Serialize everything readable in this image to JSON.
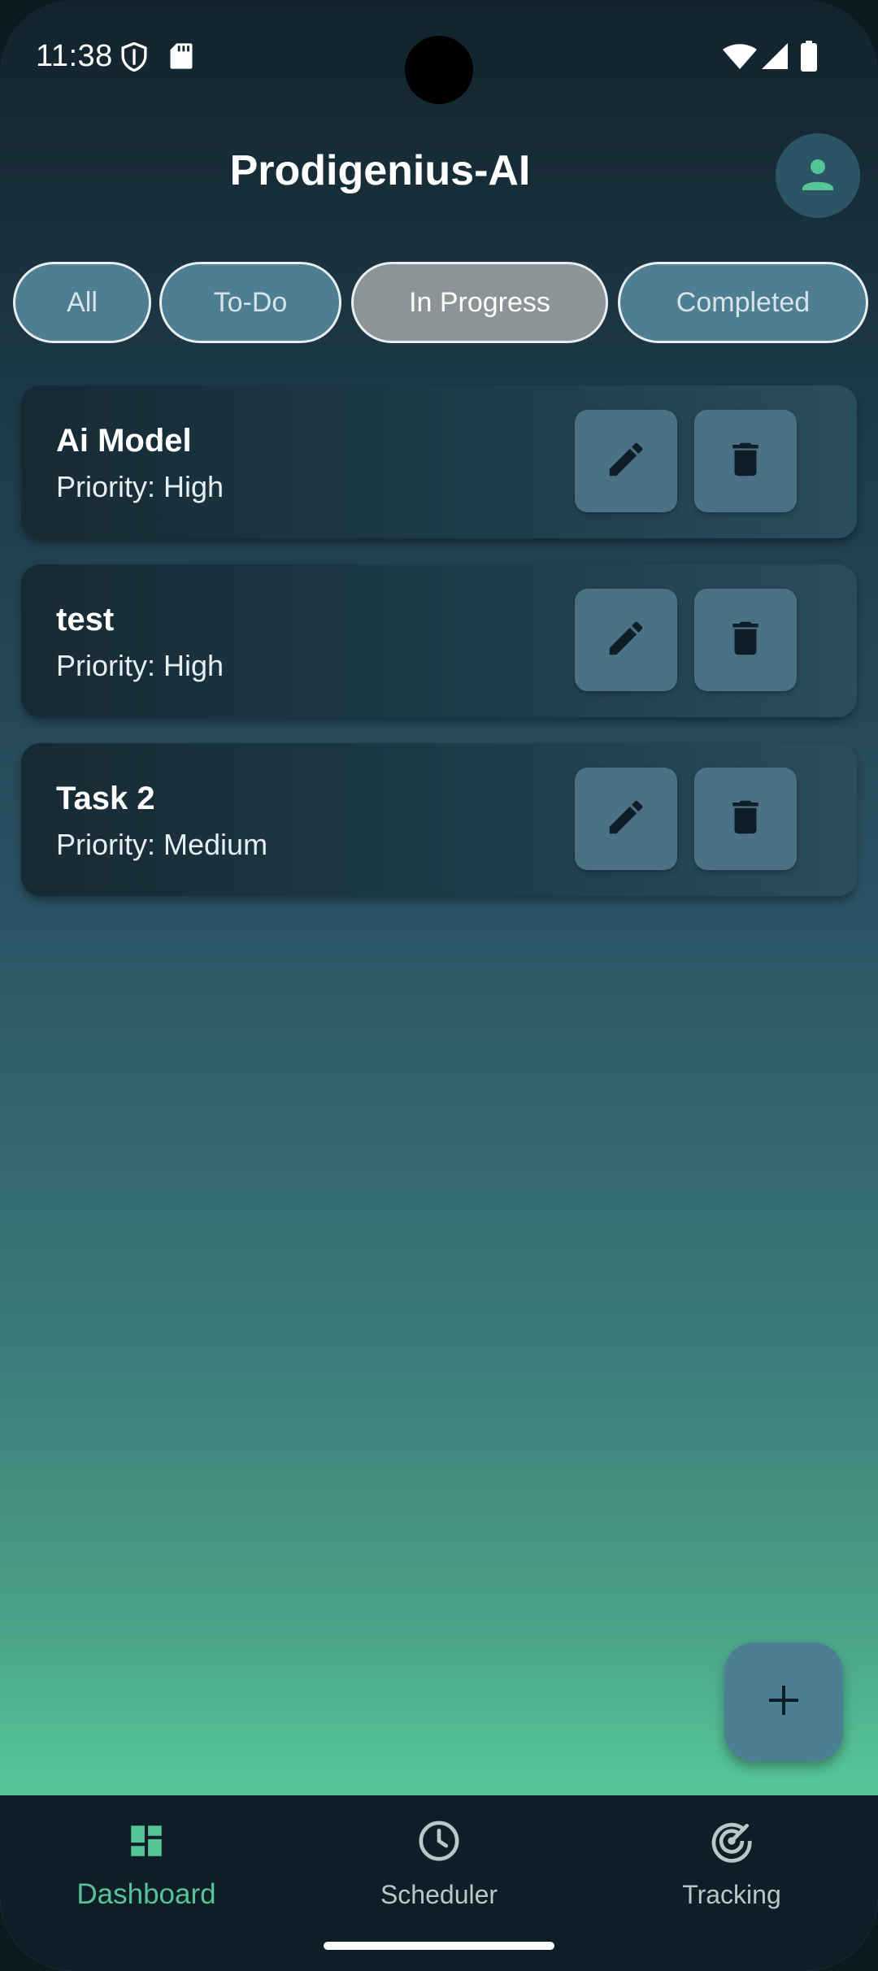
{
  "status_bar": {
    "time": "11:38"
  },
  "app": {
    "title": "Prodigenius-AI"
  },
  "filters": [
    {
      "label": "All",
      "selected": false
    },
    {
      "label": "To-Do",
      "selected": false
    },
    {
      "label": "In Progress",
      "selected": true
    },
    {
      "label": "Completed",
      "selected": false
    }
  ],
  "tasks": [
    {
      "title": "Ai Model",
      "priority": "Priority: High"
    },
    {
      "title": "test",
      "priority": "Priority: High"
    },
    {
      "title": "Task 2",
      "priority": "Priority: Medium"
    }
  ],
  "bottom_nav": [
    {
      "label": "Dashboard",
      "icon": "dashboard-icon",
      "active": true
    },
    {
      "label": "Scheduler",
      "icon": "clock-icon",
      "active": false
    },
    {
      "label": "Tracking",
      "icon": "radar-icon",
      "active": false
    }
  ],
  "colors": {
    "accent": "#55c497",
    "chip": "#4f7d92",
    "chip_selected": "#8d9496",
    "card_button": "#4a7284"
  }
}
